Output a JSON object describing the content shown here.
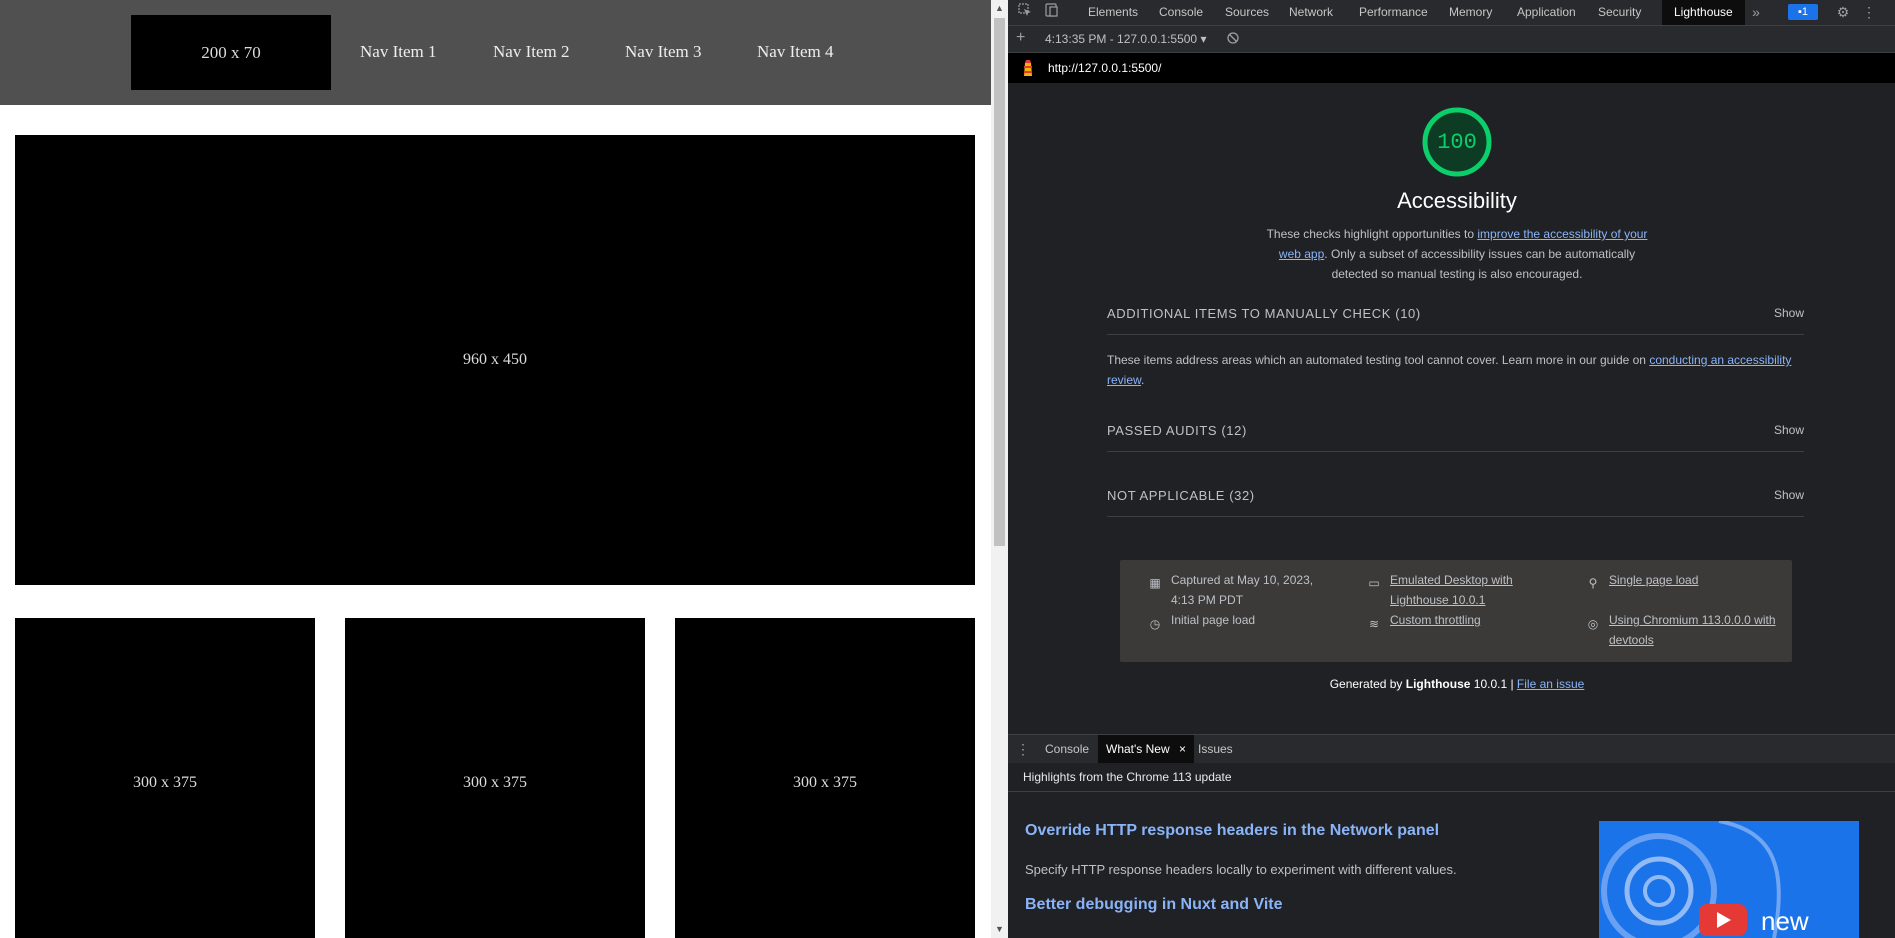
{
  "page": {
    "logo": "200 x 70",
    "nav": [
      "Nav Item 1",
      "Nav Item 2",
      "Nav Item 3",
      "Nav Item 4"
    ],
    "hero": "960 x 450",
    "cards": [
      "300 x 375",
      "300 x 375",
      "300 x 375"
    ]
  },
  "devtools": {
    "tabs": [
      "Elements",
      "Console",
      "Sources",
      "Network",
      "Performance",
      "Memory",
      "Application",
      "Security",
      "Lighthouse"
    ],
    "active_tab": "Lighthouse",
    "more_tabs": "»",
    "issues_badge": "1",
    "toolbar": {
      "add": "+",
      "report_select": "4:13:35 PM - 127.0.0.1:5500",
      "dropdown": "▾"
    },
    "url": "http://127.0.0.1:5500/",
    "report": {
      "score": "100",
      "category": "Accessibility",
      "desc_part1": "These checks highlight opportunities to ",
      "desc_link": "improve the accessibility of your web app",
      "desc_part2": ". Only a subset of accessibility issues can be automatically detected so manual testing is also encouraged.",
      "sections": [
        {
          "title": "ADDITIONAL ITEMS TO MANUALLY CHECK (10)",
          "action": "Show"
        },
        {
          "title": "PASSED AUDITS (12)",
          "action": "Show"
        },
        {
          "title": "NOT APPLICABLE (32)",
          "action": "Show"
        }
      ],
      "manual_desc_part1": "These items address areas which an automated testing tool cannot cover. Learn more in our guide on ",
      "manual_desc_link": "conducting an accessibility review",
      "manual_desc_part2": ".",
      "meta": {
        "captured": "Captured at May 10, 2023, 4:13 PM PDT",
        "initial": "Initial page load",
        "emulated": "Emulated Desktop with Lighthouse 10.0.1",
        "throttling": "Custom throttling",
        "single": "Single page load",
        "chromium": "Using Chromium 113.0.0.0 with devtools"
      },
      "footer_generated": "Generated by ",
      "footer_brand": "Lighthouse",
      "footer_version": " 10.0.1 | ",
      "footer_link": "File an issue"
    },
    "drawer": {
      "tabs": [
        "Console",
        "What's New",
        "Issues"
      ],
      "active_tab": "What's New",
      "close": "×",
      "subtitle": "Highlights from the Chrome 113 update",
      "items": [
        {
          "title": "Override HTTP response headers in the Network panel",
          "desc": "Specify HTTP response headers locally to experiment with different values."
        },
        {
          "title": "Better debugging in Nuxt and Vite"
        }
      ],
      "video_label": "new"
    }
  },
  "colors": {
    "accent": "#8ab4f8",
    "pass": "#0cce6b",
    "nav_bg": "#505050"
  }
}
